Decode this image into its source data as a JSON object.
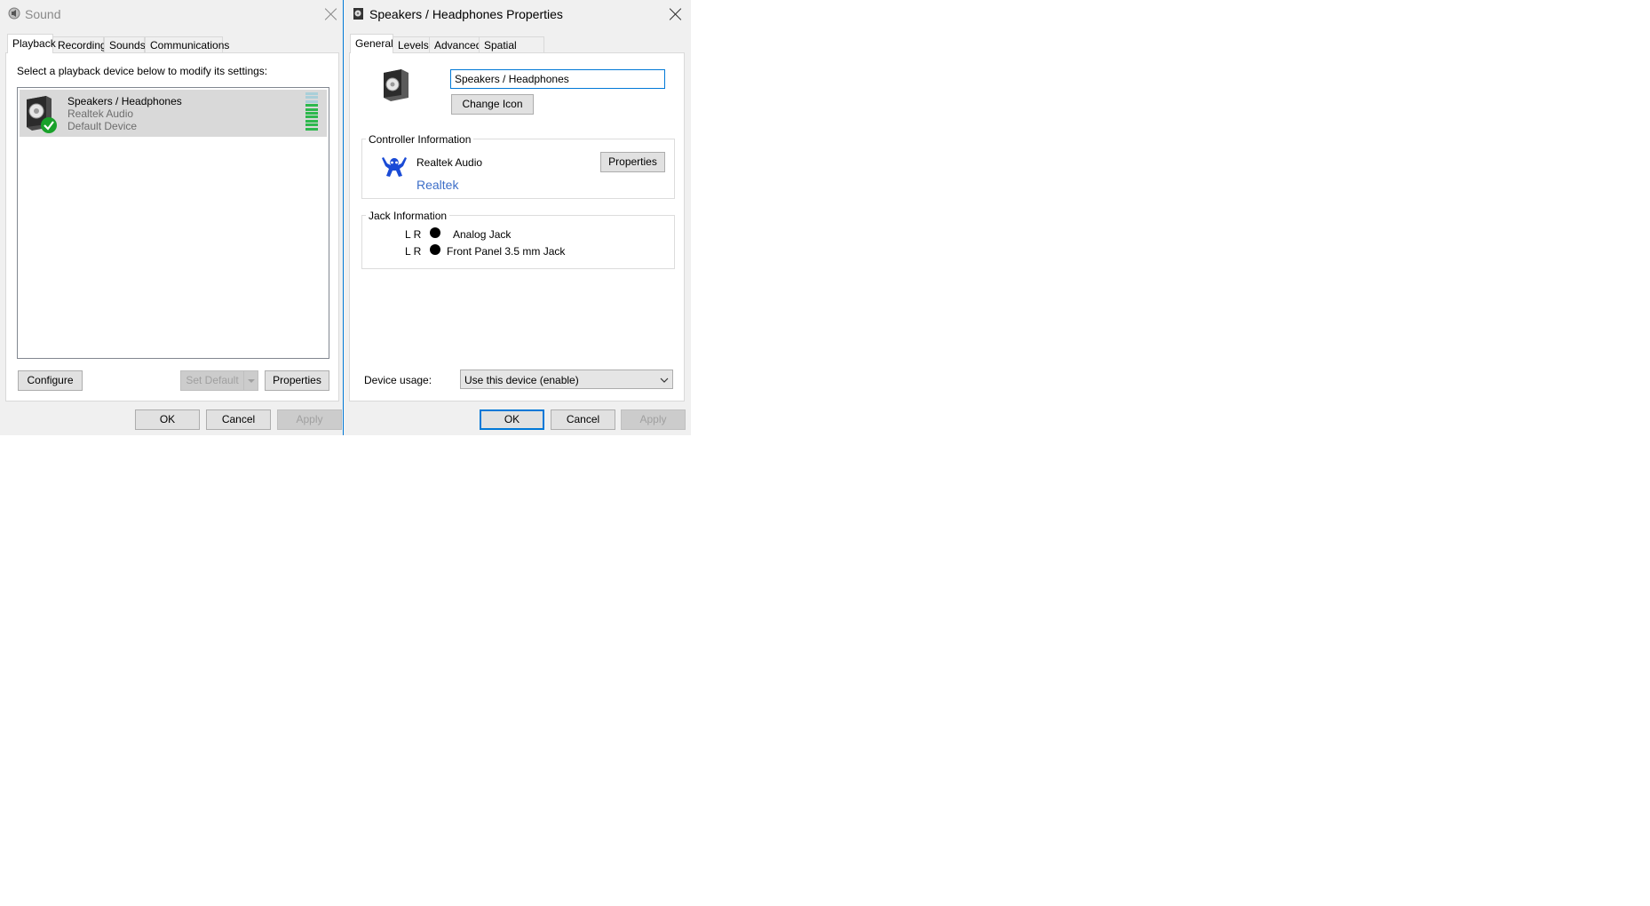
{
  "sound": {
    "title": "Sound",
    "tabs": [
      "Playback",
      "Recording",
      "Sounds",
      "Communications"
    ],
    "instruction": "Select a playback device below to modify its settings:",
    "device": {
      "name": "Speakers / Headphones",
      "driver": "Realtek Audio",
      "status": "Default Device",
      "level_fraction": 0.7
    },
    "buttons": {
      "configure": "Configure",
      "set_default": "Set Default",
      "properties": "Properties",
      "ok": "OK",
      "cancel": "Cancel",
      "apply": "Apply"
    }
  },
  "props": {
    "title": "Speakers / Headphones Properties",
    "tabs": [
      "General",
      "Levels",
      "Advanced",
      "Spatial sound"
    ],
    "name_value": "Speakers / Headphones",
    "change_icon": "Change Icon",
    "controller": {
      "label": "Controller Information",
      "name": "Realtek Audio",
      "link": "Realtek",
      "properties": "Properties"
    },
    "jack": {
      "label": "Jack Information",
      "rows": [
        {
          "channels": "L R",
          "name": "Analog Jack"
        },
        {
          "channels": "L R",
          "name": "Front Panel 3.5 mm Jack"
        }
      ]
    },
    "device_usage": {
      "label": "Device usage:",
      "value": "Use this device (enable)"
    },
    "buttons": {
      "ok": "OK",
      "cancel": "Cancel",
      "apply": "Apply"
    }
  },
  "colors": {
    "accent": "#0078d7",
    "link": "#3c6ec8",
    "level_green": "#2db84d",
    "check_green": "#19a12a"
  }
}
